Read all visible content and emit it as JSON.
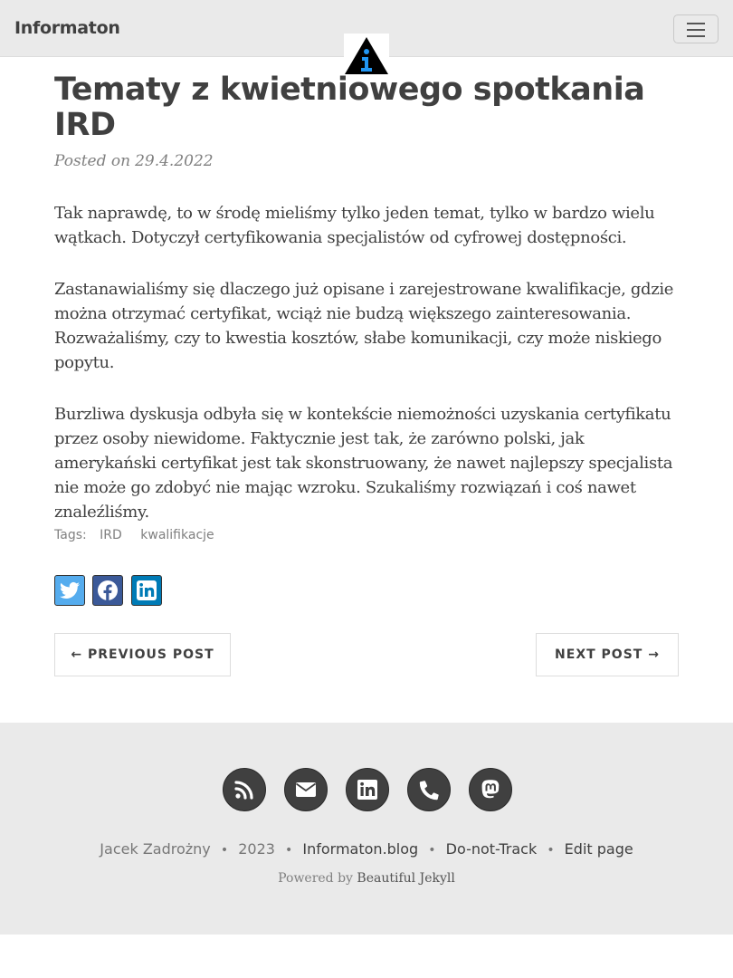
{
  "navbar": {
    "brand": "Informaton",
    "menu_icon": "hamburger-menu-icon",
    "logo_icon": "info-triangle-logo-icon",
    "logo_letter": "i"
  },
  "post": {
    "title": "Tematy z kwietniowego spotkania IRD",
    "posted_label": "Posted on",
    "date": "29.4.2022",
    "paragraphs": [
      "Tak naprawdę, to w środę mieliśmy tylko jeden temat, tylko w bardzo wielu wątkach. Dotyczył certyfikowania specjalistów od cyfrowej dostępności.",
      "Zastanawialiśmy się dlaczego już opisane i zarejestrowane kwalifikacje, gdzie można otrzymać certyfikat, wciąż nie budzą większego zainteresowania. Rozważaliśmy, czy to kwestia kosztów, słabe komunikacji, czy może niskiego popytu.",
      "Burzliwa dyskusja odbyła się w kontekście niemożności uzyskania certyfikatu przez osoby niewidome. Faktycznie jest tak, że zarówno polski, jak amerykański certyfikat jest tak skonstruowany, że nawet najlepszy specjalista nie może go zdobyć nie mając wzroku. Szukaliśmy rozwiązań i coś nawet znaleźliśmy."
    ],
    "tags_label": "Tags:",
    "tags": [
      "IRD",
      "kwalifikacje"
    ]
  },
  "share": {
    "buttons": [
      {
        "name": "twitter",
        "icon": "twitter-icon",
        "color": "#55acee"
      },
      {
        "name": "facebook",
        "icon": "facebook-icon",
        "color": "#3b5998"
      },
      {
        "name": "linkedin",
        "icon": "linkedin-icon",
        "color": "#007bb6"
      }
    ]
  },
  "pager": {
    "previous": "← PREVIOUS POST",
    "next": "NEXT POST →"
  },
  "footer": {
    "social_icons": [
      "rss-icon",
      "envelope-icon",
      "linkedin-icon",
      "phone-icon",
      "mastodon-icon"
    ],
    "author": "Jacek Zadrożny",
    "year": "2023",
    "site": "Informaton.blog",
    "dnt": "Do-not-Track",
    "edit": "Edit page",
    "separator": "•",
    "powered_by": "Powered by",
    "theme": "Beautiful Jekyll"
  },
  "colors": {
    "navbar_bg": "#eaeaea",
    "text": "#404040",
    "muted": "#808080",
    "footer_bg": "#eaeaea",
    "logo_blue": "#2196f3"
  }
}
